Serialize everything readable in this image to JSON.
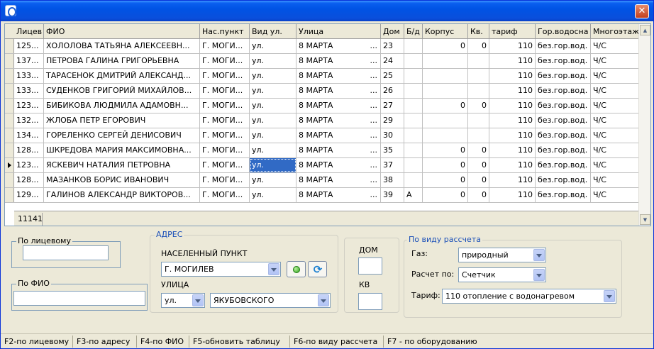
{
  "title": "",
  "grid": {
    "columns": [
      "Лицев",
      "ФИО",
      "Нас.пункт",
      "Вид ул.",
      "Улица",
      "Дом",
      "Б/д",
      "Корпус",
      "Кв.",
      "тариф",
      "Гор.водосна",
      "Многоэтаж"
    ],
    "rows": [
      [
        "125...",
        "ХОЛОЛОВА ТАТЬЯНА АЛЕКСЕЕВН...",
        "Г. МОГИ...",
        "ул.",
        "8 МАРТА",
        "23",
        "",
        "0",
        "0",
        "110",
        "без.гор.вод.",
        "Ч/С"
      ],
      [
        "137...",
        "ПЕТРОВА ГАЛИНА ГРИГОРЬЕВНА",
        "Г. МОГИ...",
        "ул.",
        "8 МАРТА",
        "24",
        "",
        "",
        "",
        "110",
        "без.гор.вод.",
        "Ч/С"
      ],
      [
        "133...",
        "ТАРАСЕНОК ДМИТРИЙ АЛЕКСАНД...",
        "Г. МОГИ...",
        "ул.",
        "8 МАРТА",
        "25",
        "",
        "",
        "",
        "110",
        "без.гор.вод.",
        "Ч/С"
      ],
      [
        "133...",
        "СУДЕНКОВ ГРИГОРИЙ МИХАЙЛОВ...",
        "Г. МОГИ...",
        "ул.",
        "8 МАРТА",
        "26",
        "",
        "",
        "",
        "110",
        "без.гор.вод.",
        "Ч/С"
      ],
      [
        "123...",
        "БИБИКОВА ЛЮДМИЛА АДАМОВН...",
        "Г. МОГИ...",
        "ул.",
        "8 МАРТА",
        "27",
        "",
        "0",
        "0",
        "110",
        "без.гор.вод.",
        "Ч/С"
      ],
      [
        "132...",
        "ЖЛОБА ПЕТР ЕГОРОВИЧ",
        "Г. МОГИ...",
        "ул.",
        "8 МАРТА",
        "29",
        "",
        "",
        "",
        "110",
        "без.гор.вод.",
        "Ч/С"
      ],
      [
        "134...",
        "ГОРЕЛЕНКО СЕРГЕЙ ДЕНИСОВИЧ",
        "Г. МОГИ...",
        "ул.",
        "8 МАРТА",
        "30",
        "",
        "",
        "",
        "110",
        "без.гор.вод.",
        "Ч/С"
      ],
      [
        "128...",
        "ШКРЕДОВА МАРИЯ МАКСИМОВНА...",
        "Г. МОГИ...",
        "ул.",
        "8 МАРТА",
        "35",
        "",
        "0",
        "0",
        "110",
        "без.гор.вод.",
        "Ч/С"
      ],
      [
        "123...",
        "ЯСКЕВИЧ НАТАЛИЯ ПЕТРОВНА",
        "Г. МОГИ...",
        "ул.",
        "8 МАРТА",
        "37",
        "",
        "0",
        "0",
        "110",
        "без.гор.вод.",
        "Ч/С"
      ],
      [
        "128...",
        "МАЗАНКОВ БОРИС ИВАНОВИЧ",
        "Г. МОГИ...",
        "ул.",
        "8 МАРТА",
        "38",
        "",
        "0",
        "0",
        "110",
        "без.гор.вод.",
        "Ч/С"
      ],
      [
        "129...",
        "ГАЛИНОВ АЛЕКСАНДР ВИКТОРОВ...",
        "Г. МОГИ...",
        "ул.",
        "8 МАРТА",
        "39",
        "А",
        "0",
        "0",
        "110",
        "без.гор.вод.",
        "Ч/С"
      ]
    ],
    "record_count": "11141"
  },
  "filters": {
    "by_account_legend": "По лицевому",
    "by_account_value": "",
    "by_name_legend": "По ФИО",
    "by_name_value": "",
    "address_legend": "АДРЕС",
    "settlement_label": "НАСЕЛЕННЫЙ ПУНКТ",
    "settlement_value": "Г. МОГИЛЕВ",
    "street_label": "УЛИЦА",
    "street_type_value": "ул.",
    "street_value": "ЯКУБОВСКОГО",
    "house_label": "ДОМ",
    "house_value": "",
    "apt_label": "КВ",
    "apt_value": "",
    "calc_legend": "По виду рассчета",
    "gas_label": "Газ:",
    "gas_value": "природный",
    "calc_by_label": "Расчет по:",
    "calc_by_value": "Счетчик",
    "tariff_label": "Тариф:",
    "tariff_value": "110  отопление с водонагревом"
  },
  "status": {
    "f2": "F2-по лицевому",
    "f3": "F3-по адресу",
    "f4": "F4-по ФИО",
    "f5": "F5-обновить таблицу",
    "f6": "F6-по виду рассчета",
    "f7": "F7 - по оборудованию"
  },
  "colors": {
    "title_bar": "#0a5fef",
    "selection": "#316ac5",
    "accent_text": "#1a4fb8"
  }
}
